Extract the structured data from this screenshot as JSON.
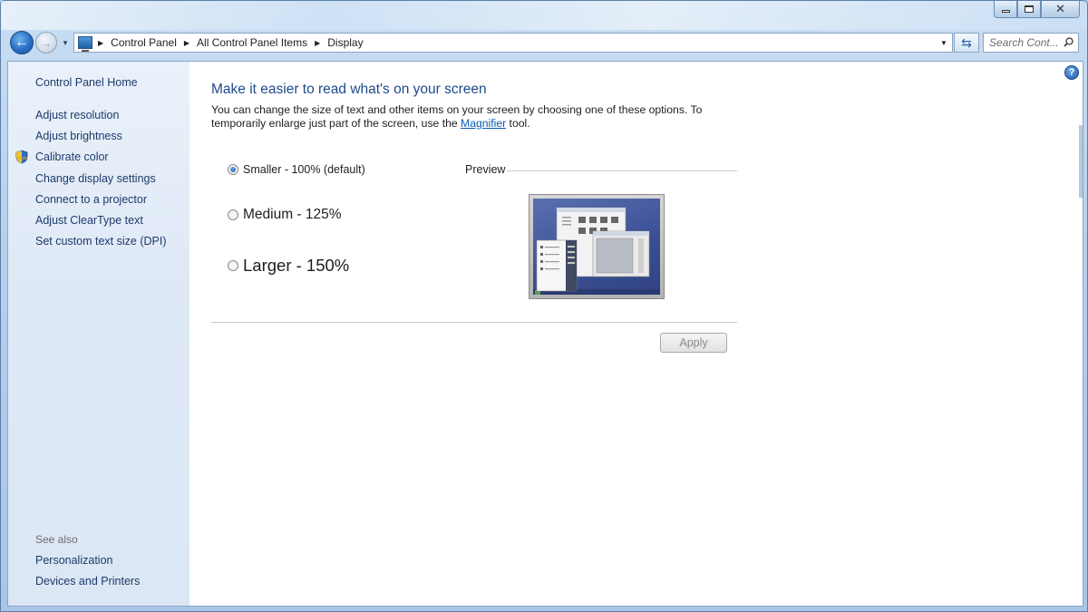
{
  "window": {
    "caption": {
      "minimize": "",
      "maximize": "",
      "close": "✕"
    }
  },
  "nav": {
    "back_glyph": "←",
    "forward_glyph": "→",
    "history_glyph": "▾",
    "breadcrumbs": [
      "Control Panel",
      "All Control Panel Items",
      "Display"
    ],
    "separator": "▶",
    "address_dropdown": "▼",
    "refresh_glyph": "⇆",
    "search_placeholder": "Search Cont..."
  },
  "sidebar": {
    "home": "Control Panel Home",
    "links": [
      "Adjust resolution",
      "Adjust brightness",
      "Calibrate color",
      "Change display settings",
      "Connect to a projector",
      "Adjust ClearType text",
      "Set custom text size (DPI)"
    ],
    "see_also_title": "See also",
    "see_also": [
      "Personalization",
      "Devices and Printers"
    ]
  },
  "main": {
    "heading": "Make it easier to read what's on your screen",
    "desc_before": "You can change the size of text and other items on your screen by choosing one of these options. To temporarily enlarge just part of the screen, use the ",
    "desc_link": "Magnifier",
    "desc_after": " tool.",
    "options": [
      {
        "label": "Smaller - 100% (default)",
        "checked": true
      },
      {
        "label": "Medium - 125%",
        "checked": false
      },
      {
        "label": "Larger - 150%",
        "checked": false
      }
    ],
    "preview_label": "Preview",
    "apply_label": "Apply",
    "help_glyph": "?"
  },
  "colors": {
    "link": "#1e3a6b",
    "heading": "#1e4a8c",
    "hyperlink": "#0a5bb8"
  }
}
